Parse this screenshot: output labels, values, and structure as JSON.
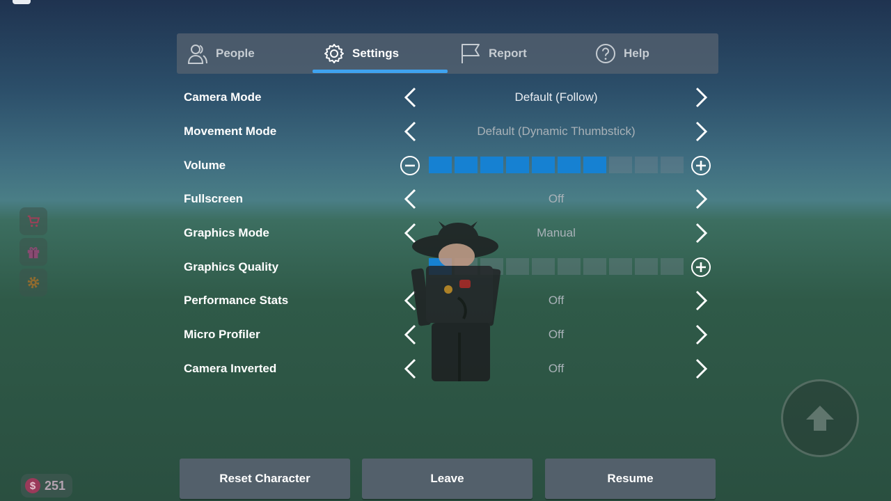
{
  "tabs": [
    {
      "label": "People",
      "icon": "people-icon"
    },
    {
      "label": "Settings",
      "icon": "gear-icon"
    },
    {
      "label": "Report",
      "icon": "flag-icon"
    },
    {
      "label": "Help",
      "icon": "help-icon"
    }
  ],
  "active_tab": "Settings",
  "settings": {
    "camera_mode": {
      "label": "Camera Mode",
      "value": "Default (Follow)"
    },
    "movement_mode": {
      "label": "Movement Mode",
      "value": "Default (Dynamic Thumbstick)"
    },
    "volume": {
      "label": "Volume",
      "level": 7,
      "max": 10
    },
    "fullscreen": {
      "label": "Fullscreen",
      "value": "Off"
    },
    "graphics_mode": {
      "label": "Graphics Mode",
      "value": "Manual"
    },
    "graphics_quality": {
      "label": "Graphics Quality",
      "level": 1,
      "max": 10
    },
    "performance_stats": {
      "label": "Performance Stats",
      "value": "Off"
    },
    "micro_profiler": {
      "label": "Micro Profiler",
      "value": "Off"
    },
    "camera_inverted": {
      "label": "Camera Inverted",
      "value": "Off"
    }
  },
  "bottom_buttons": {
    "reset": "Reset Character",
    "leave": "Leave",
    "resume": "Resume"
  },
  "currency": {
    "amount": "251",
    "symbol": "$"
  },
  "colors": {
    "accent": "#3fa3f0",
    "slider_on": "#1681d2"
  }
}
